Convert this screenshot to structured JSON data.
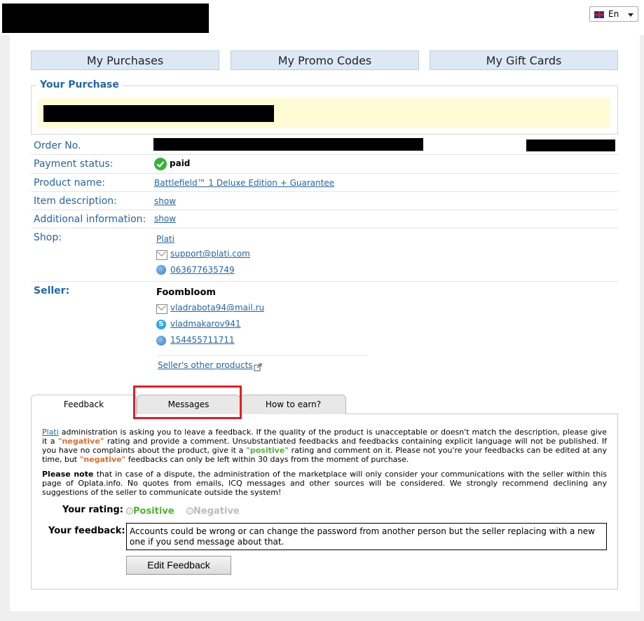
{
  "language": {
    "code": "En"
  },
  "nav": {
    "purchases": "My Purchases",
    "promo": "My Promo Codes",
    "gift": "My Gift Cards"
  },
  "purchase": {
    "heading": "Your Purchase"
  },
  "details": {
    "order_label": "Order No.",
    "payment_label": "Payment status:",
    "payment_value": "paid",
    "product_label": "Product name:",
    "product_value": "Battlefield™ 1 Deluxe Edition + Guarantee",
    "item_label": "Item description:",
    "item_value": "show",
    "additional_label": "Additional information:",
    "additional_value": "show",
    "shop_label": "Shop:",
    "shop_name": "Plati",
    "shop_email": "support@plati.com",
    "shop_icq": "063677635749",
    "seller_label": "Seller:",
    "seller_name": "Foombloom",
    "seller_email": "vladrabota94@mail.ru",
    "seller_skype": "vladmakarov941",
    "seller_icq": "154455711711",
    "seller_other": "Seller's other products"
  },
  "tabs": {
    "feedback": "Feedback",
    "messages": "Messages",
    "earn": "How to earn?"
  },
  "feedback": {
    "p1_link": "Plati",
    "p1_a": " administration is asking you to leave a feedback. If the quality of the product is unacceptable or doesn't match the description, please give it a ",
    "negative_q": "\"negative\"",
    "p1_b": " rating and provide a comment. Unsubstantiated feedbacks and feedbacks containing explicit language will not be published. If you have no complaints about the product, give it a ",
    "positive_q": "\"positive\"",
    "p1_c": " rating and comment on it. Please not you're your feedbacks can be edited at any time, but ",
    "negative_q2": "\"negative\"",
    "p1_d": " feedbacks can only be left within 30 days from the moment of purchase.",
    "note_bold": "Please note",
    "note_text": " that in case of a dispute, the administration of the marketplace will only consider your communications with the seller within this page of Oplata.info. No quotes from emails, ICQ messages and other sources will be considered. We strongly recommend declining any suggestions of the seller to communicate outside the system!",
    "rating_label": "Your rating:",
    "rating_positive": "Positive",
    "rating_negative": "Negative",
    "feedback_label": "Your feedback:",
    "feedback_text": "Accounts could be wrong or can change the password from another person but the seller replacing with a new one if you send message about that.",
    "edit_button": "Edit Feedback"
  },
  "colors": {
    "accent": "#2166a8",
    "highlight": "#e41e26",
    "positive": "#4cb52e",
    "negative": "#e06b2a"
  }
}
